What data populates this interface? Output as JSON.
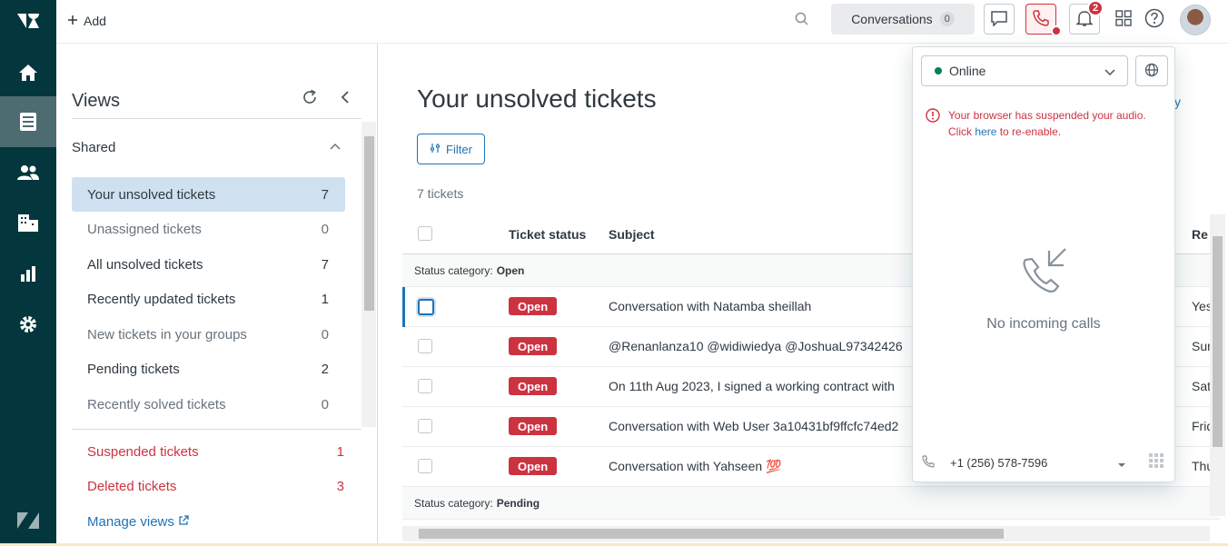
{
  "topbar": {
    "add_label": "Add",
    "conversations_label": "Conversations",
    "conversations_count": "0",
    "notifications_count": "2"
  },
  "views": {
    "title": "Views",
    "shared_label": "Shared",
    "items": [
      {
        "label": "Your unsolved tickets",
        "count": "7"
      },
      {
        "label": "Unassigned tickets",
        "count": "0"
      },
      {
        "label": "All unsolved tickets",
        "count": "7"
      },
      {
        "label": "Recently updated tickets",
        "count": "1"
      },
      {
        "label": "New tickets in your groups",
        "count": "0"
      },
      {
        "label": "Pending tickets",
        "count": "2"
      },
      {
        "label": "Recently solved tickets",
        "count": "0"
      }
    ],
    "suspended": {
      "label": "Suspended tickets",
      "count": "1"
    },
    "deleted": {
      "label": "Deleted tickets",
      "count": "3"
    },
    "manage_label": "Manage views"
  },
  "main": {
    "title": "Your unsolved tickets",
    "filter_label": "Filter",
    "ticket_count": "7 tickets",
    "partial_link": "y",
    "columns": {
      "status": "Ticket status",
      "subject": "Subject",
      "requester": "Re"
    },
    "group_open": {
      "prefix": "Status category:",
      "value": "Open"
    },
    "group_pending": {
      "prefix": "Status category:",
      "value": "Pending"
    },
    "rows": [
      {
        "status": "Open",
        "subject": "Conversation with Natamba sheillah",
        "req": "Yes"
      },
      {
        "status": "Open",
        "subject": "@Renanlanza10 @widiwiedya @JoshuaL97342426",
        "req": "Sur"
      },
      {
        "status": "Open",
        "subject": "On 11th Aug 2023, I signed a working contract with",
        "req": "Sat"
      },
      {
        "status": "Open",
        "subject": "Conversation with Web User 3a10431bf9ffcfc74ed2",
        "req": "Frid"
      },
      {
        "status": "Open",
        "subject": "Conversation with Yahseen 💯",
        "req": "Thu"
      }
    ]
  },
  "talk": {
    "status": "Online",
    "warning_line1": "Your browser has suspended your audio.",
    "warning_click": "Click ",
    "warning_link": "here",
    "warning_tail": " to re-enable.",
    "no_calls": "No incoming calls",
    "phone_number": "+1 (256) 578-7596"
  },
  "colors": {
    "rail": "#03363d",
    "accent": "#1f73b7",
    "danger": "#cc3340",
    "online": "#038153"
  }
}
